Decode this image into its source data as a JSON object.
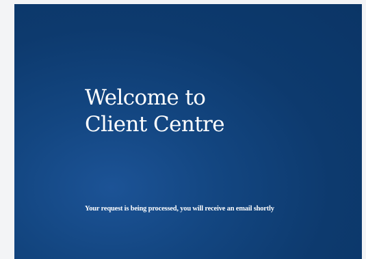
{
  "welcome": {
    "title_line1": "Welcome to",
    "title_line2": "Client Centre",
    "message": "Your request is being processed, you will receive an email shortly"
  },
  "colors": {
    "page_background": "#f3f4f6",
    "panel_background": "#0d3a6e",
    "text": "#ffffff"
  }
}
